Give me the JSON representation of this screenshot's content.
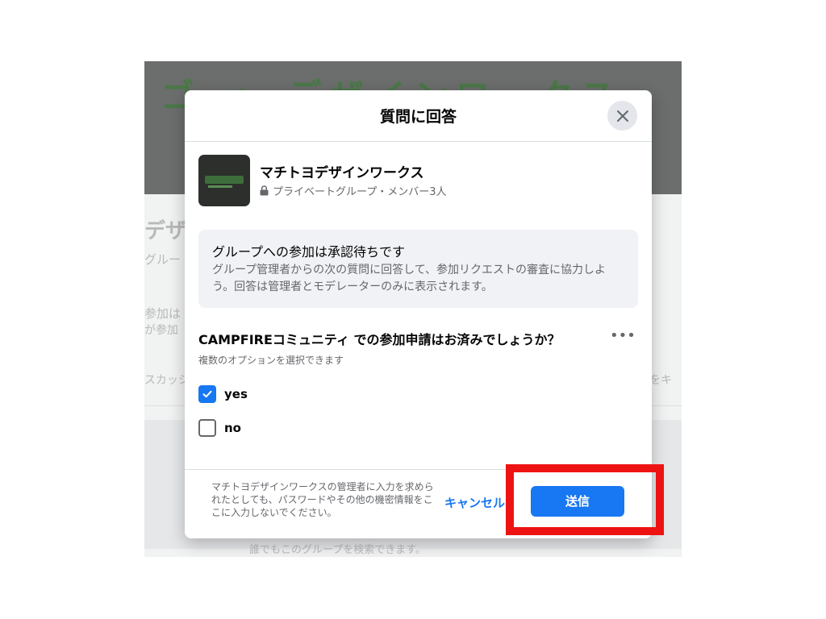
{
  "background": {
    "cover_text": "ゴ ◎ デザインワークス",
    "title": "デザ",
    "subtitle": "グルー",
    "join_line1": "参加は",
    "join_line2": "が参加",
    "discussion": "スカッシ",
    "right_text": "トをキ",
    "bottom_text": "誰でもこのグループを検索できます。"
  },
  "modal": {
    "title": "質問に回答",
    "close_icon": "close-icon",
    "group": {
      "name": "マチトヨデザインワークス",
      "meta": "プライベートグループ・メンバー3人",
      "lock_icon": "lock-icon"
    },
    "notice": {
      "title": "グループへの参加は承認待ちです",
      "body": "グループ管理者からの次の質問に回答して、参加リクエストの審査に協力しよう。回答は管理者とモデレーターのみに表示されます。"
    },
    "question": {
      "text": "CAMPFIREコミュニティ での参加申請はお済みでしょうか？",
      "hint": "複数のオプションを選択できます",
      "more_label": "•••",
      "options": [
        {
          "label": "yes",
          "checked": true
        },
        {
          "label": "no",
          "checked": false
        }
      ]
    },
    "footer": {
      "note": "マチトヨデザインワークスの管理者に入力を求められたとしても、パスワードやその他の機密情報をここに入力しないでください。",
      "cancel_label": "キャンセル",
      "submit_label": "送信"
    }
  },
  "colors": {
    "accent": "#1877f2",
    "highlight": "#ee1313"
  }
}
